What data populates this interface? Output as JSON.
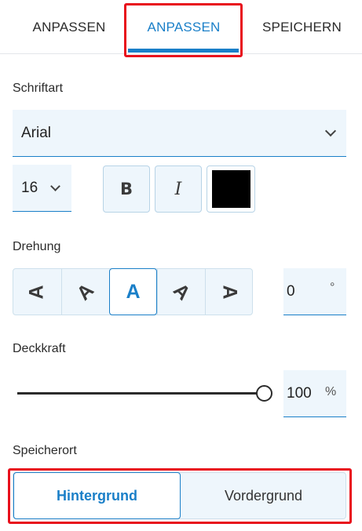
{
  "tabs": [
    {
      "label": "ANPASSEN"
    },
    {
      "label": "ANPASSEN"
    },
    {
      "label": "SPEICHERN"
    }
  ],
  "accent_color": "#1a7fc8",
  "highlight_color": "#e8101c",
  "font": {
    "section_label": "Schriftart",
    "family": "Arial",
    "size": "16",
    "bold_label": "B",
    "italic_label": "I",
    "color": "#000000"
  },
  "rotation": {
    "section_label": "Drehung",
    "options": [
      "A",
      "A",
      "A",
      "A",
      "A"
    ],
    "selected_index": 2,
    "value": "0",
    "unit": "°"
  },
  "opacity": {
    "section_label": "Deckkraft",
    "value": "100",
    "unit": "%",
    "level": 1.0
  },
  "location": {
    "section_label": "Speicherort",
    "options": [
      "Hintergrund",
      "Vordergrund"
    ],
    "selected_index": 0
  }
}
